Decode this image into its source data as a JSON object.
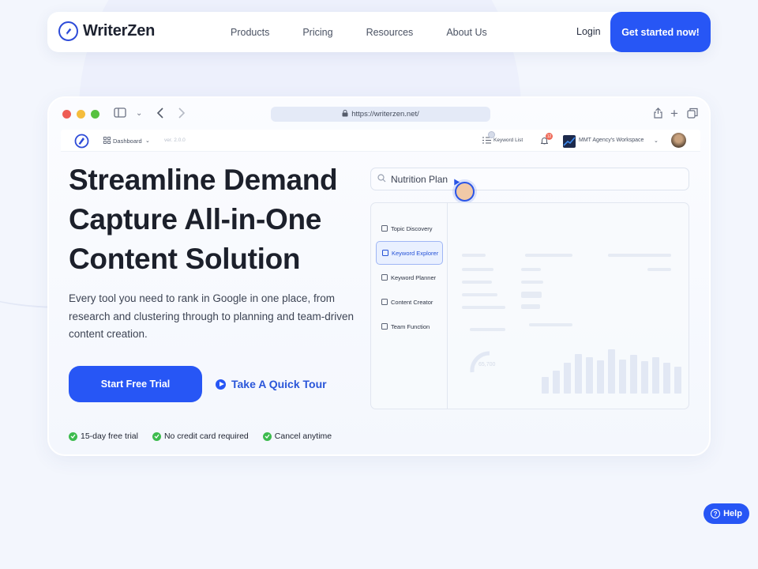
{
  "nav": {
    "brand": "WriterZen",
    "links": [
      "Products",
      "Pricing",
      "Resources",
      "About Us"
    ],
    "login": "Login",
    "cta": "Get started now!"
  },
  "browser": {
    "url": "https://writerzen.net/",
    "app_bar": {
      "dashboard": "Dashboard",
      "version": "ver. 2.0.0",
      "keyword_list": "Keyword List",
      "notif_count": "12",
      "workspace": "MMT Agency's Workspace"
    }
  },
  "hero": {
    "title": "Streamline Demand Capture All-in-One Content Solution",
    "subtitle": "Every tool you need to rank in Google in one place, from research and clustering through to planning and team-driven content creation.",
    "primary_cta": "Start Free Trial",
    "secondary_cta": "Take A Quick Tour",
    "perks": [
      "15-day free trial",
      "No credit card required",
      "Cancel anytime"
    ]
  },
  "mockup": {
    "search_value": "Nutrition Plan",
    "menu": [
      {
        "label": "Topic Discovery",
        "active": false
      },
      {
        "label": "Keyword Explorer",
        "active": true
      },
      {
        "label": "Keyword Planner",
        "active": false
      },
      {
        "label": "Content Creator",
        "active": false
      },
      {
        "label": "Team Function",
        "active": false
      }
    ],
    "chart_bars": [
      0.3,
      0.42,
      0.55,
      0.72,
      0.65,
      0.6,
      0.8,
      0.62,
      0.7,
      0.58,
      0.66,
      0.55,
      0.48
    ],
    "gauge_value": "65,700"
  },
  "help": {
    "label": "Help"
  },
  "colors": {
    "accent": "#2756f5",
    "success": "#3dbb4e",
    "text": "#1c202b"
  }
}
